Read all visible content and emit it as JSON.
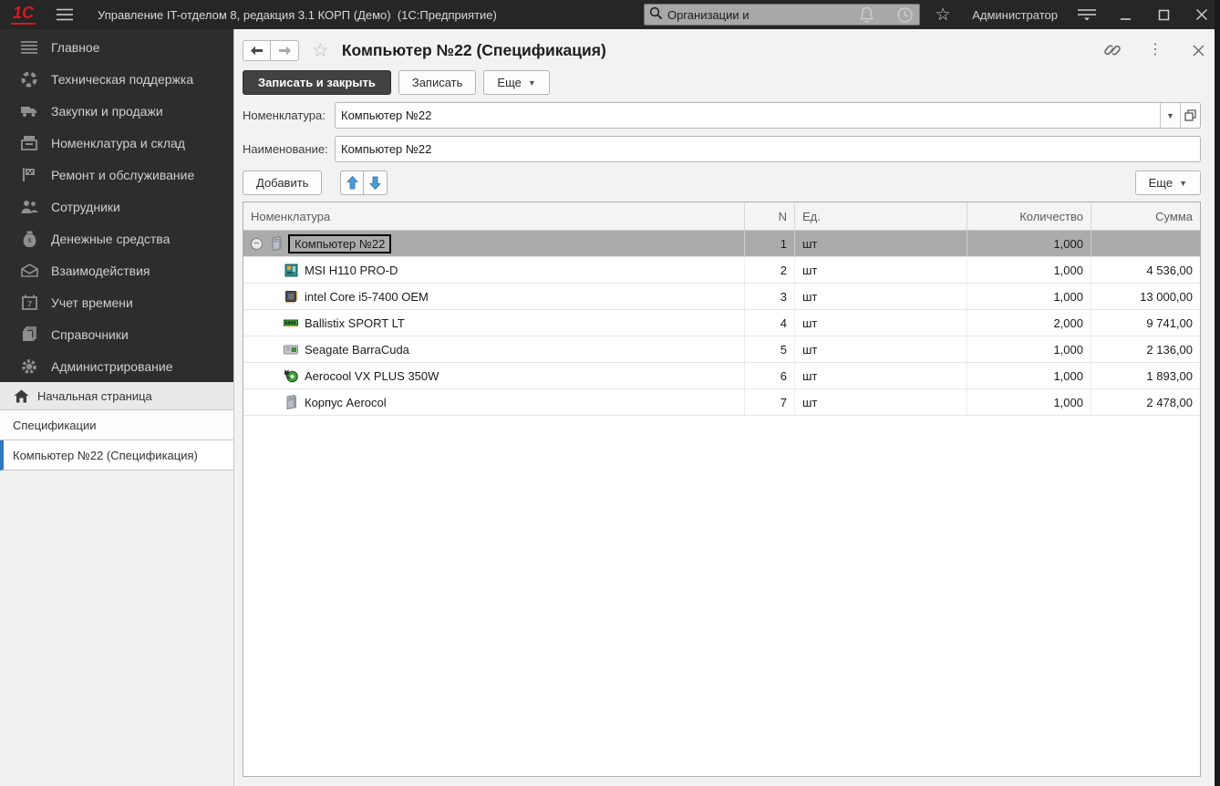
{
  "titlebar": {
    "logo": "1С",
    "app_title": "Управление IT-отделом 8, редакция 3.1 КОРП (Демо)  (1С:Предприятие)",
    "search": {
      "value": "Организации и"
    },
    "user_name": "Администратор"
  },
  "sidebar": {
    "items": [
      {
        "label": "Главное",
        "icon": "menu-lines"
      },
      {
        "label": "Техническая поддержка",
        "icon": "support"
      },
      {
        "label": "Закупки и продажи",
        "icon": "truck"
      },
      {
        "label": "Номенклатура и склад",
        "icon": "warehouse"
      },
      {
        "label": "Ремонт и обслуживание",
        "icon": "repair"
      },
      {
        "label": "Сотрудники",
        "icon": "employees"
      },
      {
        "label": "Денежные средства",
        "icon": "money"
      },
      {
        "label": "Взаимодействия",
        "icon": "mail"
      },
      {
        "label": "Учет времени",
        "icon": "calendar"
      },
      {
        "label": "Справочники",
        "icon": "books"
      },
      {
        "label": "Администрирование",
        "icon": "gear"
      }
    ],
    "tabs": [
      {
        "label": "Начальная страница",
        "icon": "home",
        "kind": "home",
        "active": false
      },
      {
        "label": "Спецификации",
        "kind": "plain",
        "active": false
      },
      {
        "label": "Компьютер №22 (Спецификация)",
        "kind": "plain",
        "active": true
      }
    ]
  },
  "page": {
    "title": "Компьютер №22 (Спецификация)",
    "buttons": {
      "save_close": "Записать и закрыть",
      "save": "Записать",
      "more": "Еще",
      "add": "Добавить"
    },
    "fields": {
      "nomenclature_label": "Номенклатура:",
      "nomenclature_value": "Компьютер №22",
      "name_label": "Наименование:",
      "name_value": "Компьютер №22"
    }
  },
  "table": {
    "columns": {
      "name": "Номенклатура",
      "n": "N",
      "unit": "Ед.",
      "qty": "Количество",
      "sum": "Сумма"
    },
    "rows": [
      {
        "name": "Компьютер №22",
        "n": "1",
        "unit": "шт",
        "qty": "1,000",
        "sum": "",
        "level": 0,
        "selected": true,
        "expanded": true,
        "icon": "pc-case"
      },
      {
        "name": "MSI H110 PRO-D",
        "n": "2",
        "unit": "шт",
        "qty": "1,000",
        "sum": "4 536,00",
        "level": 1,
        "selected": false,
        "icon": "motherboard"
      },
      {
        "name": "intel Core i5-7400 OEM",
        "n": "3",
        "unit": "шт",
        "qty": "1,000",
        "sum": "13 000,00",
        "level": 1,
        "selected": false,
        "icon": "cpu"
      },
      {
        "name": "Ballistix SPORT LT",
        "n": "4",
        "unit": "шт",
        "qty": "2,000",
        "sum": "9 741,00",
        "level": 1,
        "selected": false,
        "icon": "ram"
      },
      {
        "name": "Seagate BarraCuda",
        "n": "5",
        "unit": "шт",
        "qty": "1,000",
        "sum": "2 136,00",
        "level": 1,
        "selected": false,
        "icon": "hdd"
      },
      {
        "name": "Aerocool VX PLUS 350W",
        "n": "6",
        "unit": "шт",
        "qty": "1,000",
        "sum": "1 893,00",
        "level": 1,
        "selected": false,
        "icon": "psu"
      },
      {
        "name": "Корпус Aerocol",
        "n": "7",
        "unit": "шт",
        "qty": "1,000",
        "sum": "2 478,00",
        "level": 1,
        "selected": false,
        "icon": "pc-case"
      }
    ]
  }
}
